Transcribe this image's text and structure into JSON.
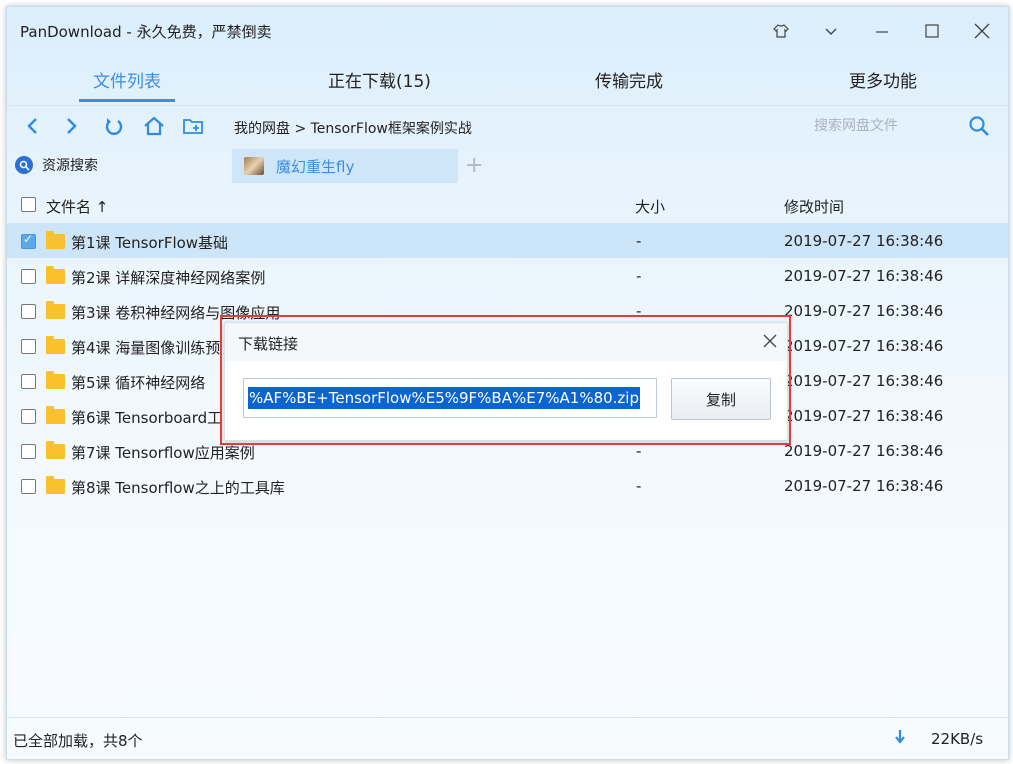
{
  "window": {
    "title": "PanDownload - 永久免费，严禁倒卖"
  },
  "nav_tabs": [
    {
      "label": "文件列表",
      "active": true
    },
    {
      "label": "正在下载(15)",
      "active": false
    },
    {
      "label": "传输完成",
      "active": false
    },
    {
      "label": "更多功能",
      "active": false
    }
  ],
  "toolbar": {
    "breadcrumb": "我的网盘 > TensorFlow框架案例实战",
    "search_placeholder": "搜索网盘文件"
  },
  "session_bar": {
    "resource_search": "资源搜索",
    "user_tab": "魔幻重生fly",
    "add_tab": "+"
  },
  "table": {
    "columns": {
      "name": "文件名",
      "sort_indicator": "↑",
      "size": "大小",
      "time": "修改时间"
    },
    "rows": [
      {
        "name": "第1课 TensorFlow基础",
        "size": "-",
        "time": "2019-07-27 16:38:46",
        "checked": true
      },
      {
        "name": "第2课 详解深度神经网络案例",
        "size": "-",
        "time": "2019-07-27 16:38:46",
        "checked": false
      },
      {
        "name": "第3课 卷积神经网络与图像应用",
        "size": "-",
        "time": "2019-07-27 16:38:46",
        "checked": false
      },
      {
        "name": "第4课 海量图像训练预",
        "size": "-",
        "time": "2019-07-27 16:38:46",
        "checked": false
      },
      {
        "name": "第5课 循环神经网络",
        "size": "-",
        "time": "2019-07-27 16:38:46",
        "checked": false
      },
      {
        "name": "第6课 Tensorboard工",
        "size": "-",
        "time": "2019-07-27 16:38:46",
        "checked": false
      },
      {
        "name": "第7课 Tensorflow应用案例",
        "size": "-",
        "time": "2019-07-27 16:38:46",
        "checked": false
      },
      {
        "name": "第8课 Tensorflow之上的工具库",
        "size": "-",
        "time": "2019-07-27 16:38:46",
        "checked": false
      }
    ]
  },
  "status": {
    "text": "已全部加载，共8个",
    "speed": "22KB/s"
  },
  "dialog": {
    "title": "下载链接",
    "link_value": "%AF%BE+TensorFlow%E5%9F%BA%E7%A1%80.zip",
    "copy_label": "复制"
  },
  "colors": {
    "accent": "#3a8ee6",
    "highlight_border": "#e23c3c",
    "folder": "#f9c12b",
    "selected_row": "#cde5f8"
  }
}
